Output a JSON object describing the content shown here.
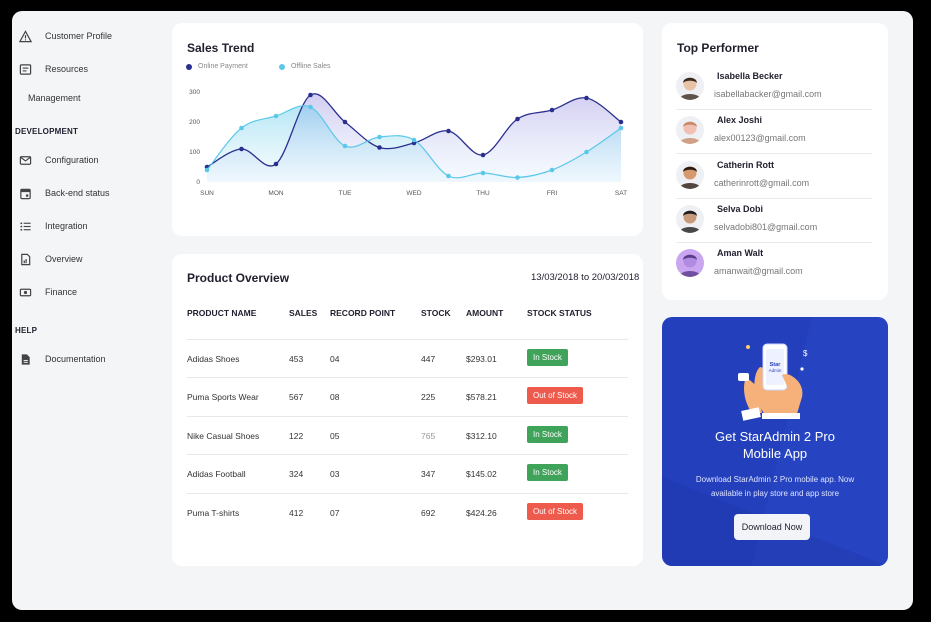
{
  "sidebar": {
    "items_top": [
      {
        "label": "Customer Profile",
        "icon": "warning-icon"
      },
      {
        "label": "Resources",
        "icon": "list-box-icon"
      }
    ],
    "sub_item": "Management",
    "section_development": "DEVELOPMENT",
    "items_dev": [
      {
        "label": "Configuration",
        "icon": "mail-icon"
      },
      {
        "label": "Back-end status",
        "icon": "calendar-icon"
      },
      {
        "label": "Integration",
        "icon": "list-icon"
      },
      {
        "label": "Overview",
        "icon": "file-chart-icon"
      },
      {
        "label": "Finance",
        "icon": "cash-icon"
      }
    ],
    "section_help": "HELP",
    "items_help": [
      {
        "label": "Documentation",
        "icon": "document-icon"
      }
    ]
  },
  "sales_trend": {
    "title": "Sales Trend",
    "legend": [
      "Online Payment",
      "Offline Sales"
    ]
  },
  "chart_data": {
    "type": "area",
    "categories": [
      "SUN",
      "MON",
      "TUE",
      "WED",
      "THU",
      "FRI",
      "SAT"
    ],
    "x_points": [
      0,
      0.5,
      1,
      1.5,
      2,
      2.5,
      3,
      3.5,
      4,
      4.5,
      5,
      5.5,
      6
    ],
    "series": [
      {
        "name": "Online Payment",
        "color": "#2a2f8f",
        "values": [
          50,
          110,
          60,
          290,
          200,
          115,
          130,
          170,
          90,
          210,
          240,
          280,
          200
        ]
      },
      {
        "name": "Offline Sales",
        "color": "#5bc8ea",
        "values": [
          40,
          180,
          220,
          250,
          120,
          150,
          140,
          20,
          30,
          15,
          40,
          100,
          180
        ]
      }
    ],
    "yticks": [
      0,
      100,
      200,
      300
    ],
    "ylim": [
      0,
      330
    ],
    "grid": false,
    "legend": "top-left"
  },
  "product_overview": {
    "title": "Product Overview",
    "date_range": "13/03/2018 to 20/03/2018",
    "headers": [
      "PRODUCT NAME",
      "SALES",
      "RECORD POINT",
      "STOCK",
      "AMOUNT",
      "STOCK STATUS"
    ],
    "rows": [
      {
        "name": "Adidas Shoes",
        "sales": "453",
        "record": "04",
        "stock": "447",
        "amount": "$293.01",
        "status": "In Stock",
        "in_stock": true
      },
      {
        "name": "Puma Sports Wear",
        "sales": "567",
        "record": "08",
        "stock": "225",
        "amount": "$578.21",
        "status": "Out of Stock",
        "in_stock": false
      },
      {
        "name": "Nike Casual Shoes",
        "sales": "122",
        "record": "05",
        "stock": "765",
        "amount": "$312.10",
        "status": "In Stock",
        "in_stock": true
      },
      {
        "name": "Adidas Football",
        "sales": "324",
        "record": "03",
        "stock": "347",
        "amount": "$145.02",
        "status": "In Stock",
        "in_stock": true
      },
      {
        "name": "Puma T-shirts",
        "sales": "412",
        "record": "07",
        "stock": "692",
        "amount": "$424.26",
        "status": "Out of Stock",
        "in_stock": false
      }
    ]
  },
  "top_performer": {
    "title": "Top Performer",
    "people": [
      {
        "name": "Isabella Becker",
        "email": "isabellabacker@gmail.com"
      },
      {
        "name": "Alex Joshi",
        "email": "alex00123@gmail.com"
      },
      {
        "name": "Catherin Rott",
        "email": "catherinrott@gmail.com"
      },
      {
        "name": "Selva Dobi",
        "email": "selvadobi801@gmail.com"
      },
      {
        "name": "Aman Walt",
        "email": "amanwait@gmail.com"
      }
    ]
  },
  "promo": {
    "title_line1": "Get StarAdmin 2 Pro",
    "title_line2": "Mobile App",
    "text_line1": "Download StarAdmin 2 Pro mobile app. Now",
    "text_line2": "available in play store and app store",
    "button": "Download Now",
    "phone_label": "Star Admin"
  },
  "colors": {
    "accent": "#233fbc",
    "online": "#2a2f8f",
    "offline": "#5bc8ea",
    "in_stock": "#3fa35a",
    "out_of_stock": "#ee5b4d"
  }
}
